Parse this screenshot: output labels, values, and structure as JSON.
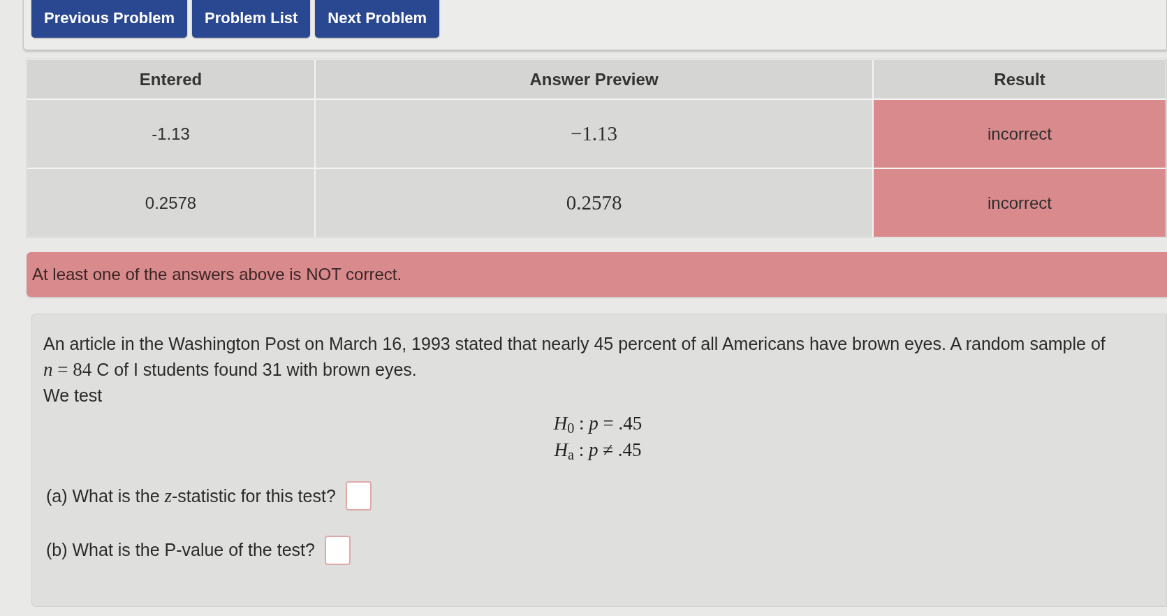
{
  "nav_buttons": [
    {
      "label": "Previous Problem"
    },
    {
      "label": "Problem List"
    },
    {
      "label": "Next Problem"
    }
  ],
  "results_table": {
    "columns": [
      "Entered",
      "Answer Preview",
      "Result"
    ],
    "rows": [
      {
        "entered": "-1.13",
        "answer_preview": "−1.13",
        "result": "incorrect",
        "correct": false
      },
      {
        "entered": "0.2578",
        "answer_preview": "0.2578",
        "result": "incorrect",
        "correct": false
      }
    ]
  },
  "alert": {
    "kind": "error",
    "text": "At least one of the answers above is NOT correct."
  },
  "problem": {
    "statement": [
      {
        "kind": "text",
        "text": "An article in the Washington Post on March 16, 1993 stated that nearly 45 percent of all Americans have brown eyes. A random sample of "
      },
      {
        "kind": "math",
        "text": "*n* = 84"
      },
      {
        "kind": "text",
        "text": " C of I students found 31 with brown eyes."
      }
    ],
    "lead_in": "We test",
    "hypotheses": [
      "*H*$_{0}$ : *p* = .45",
      "*H*$_{a}$ : *p* ≠ .45"
    ],
    "questions": [
      {
        "label": "(a) What is the *z*-statistic for this test?",
        "correct": false
      },
      {
        "label": "(b) What is the P-value of the test?",
        "correct": false
      }
    ]
  }
}
